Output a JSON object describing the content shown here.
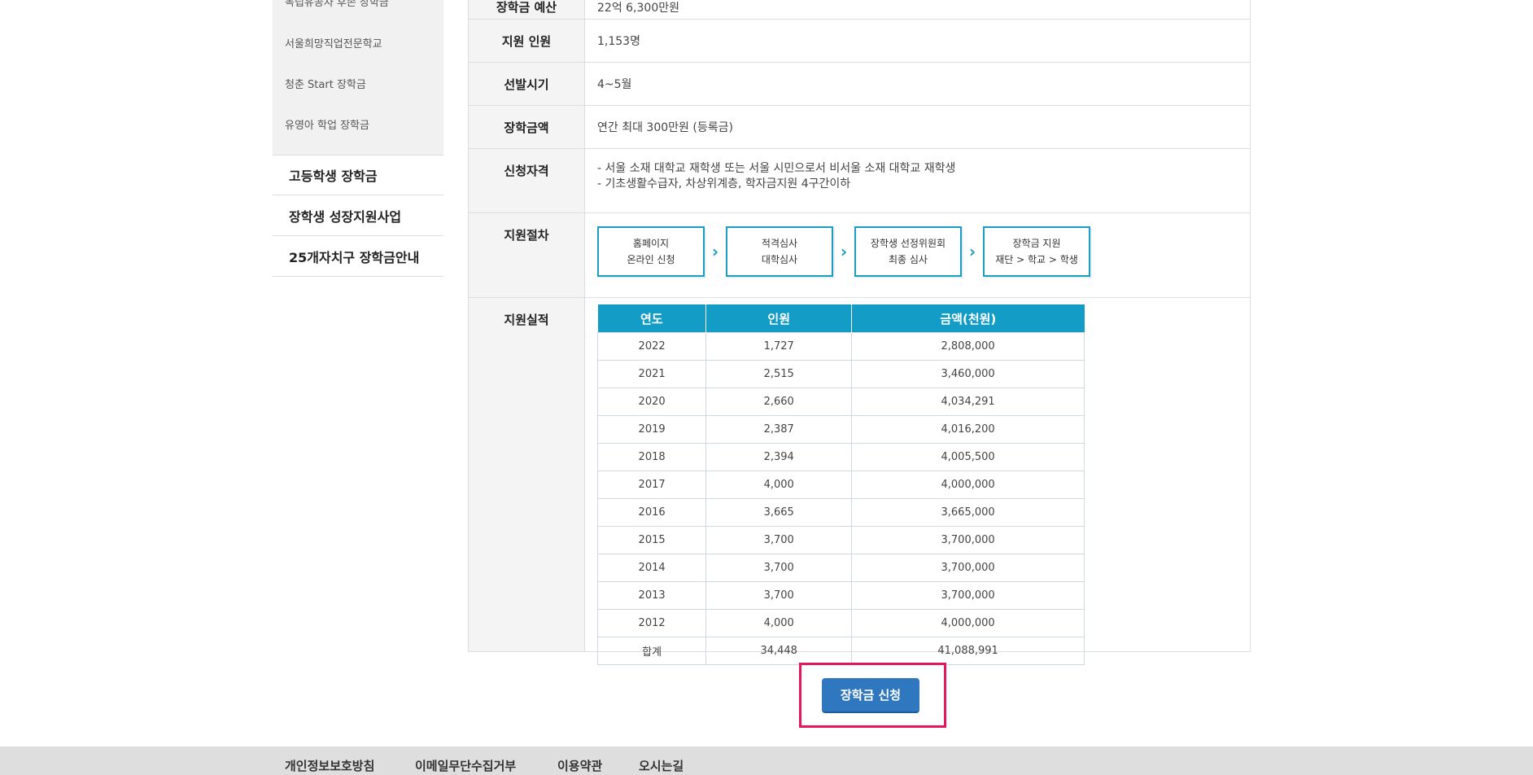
{
  "sidebar": {
    "sub_items": [
      "독립유공자 후손 장학금",
      "서울희망직업전문학교",
      "청춘 Start 장학금",
      "유영아 학업 장학금"
    ],
    "main_items": [
      "고등학생 장학금",
      "장학생 성장지원사업",
      "25개자치구 장학금안내"
    ]
  },
  "info": {
    "top_label": "장학금 예산",
    "top_value": "22억 6,300만원",
    "rows": {
      "people": {
        "label": "지원 인원",
        "value": "1,153명"
      },
      "period": {
        "label": "선발시기",
        "value": "4~5월"
      },
      "amount": {
        "label": "장학금액",
        "value": "연간 최대 300만원 (등록금)"
      },
      "eligibility": {
        "label": "신청자격",
        "line1": "- 서울 소재 대학교 재학생 또는 서울 시민으로서 비서울 소재 대학교 재학생",
        "line2": "- 기초생활수급자, 차상위계층, 학자금지원 4구간이하"
      },
      "procedure": {
        "label": "지원절차",
        "steps": [
          {
            "line1": "홈페이지",
            "line2": "온라인 신청"
          },
          {
            "line1": "적격심사",
            "line2": "대학심사"
          },
          {
            "line1": "장학생 선정위원회",
            "line2": "최종 심사"
          },
          {
            "line1": "장학금 지원",
            "line2": "재단 > 학교 > 학생"
          }
        ]
      },
      "results": {
        "label": "지원실적",
        "headers": [
          "연도",
          "인원",
          "금액(천원)"
        ],
        "rows": [
          [
            "2022",
            "1,727",
            "2,808,000"
          ],
          [
            "2021",
            "2,515",
            "3,460,000"
          ],
          [
            "2020",
            "2,660",
            "4,034,291"
          ],
          [
            "2019",
            "2,387",
            "4,016,200"
          ],
          [
            "2018",
            "2,394",
            "4,005,500"
          ],
          [
            "2017",
            "4,000",
            "4,000,000"
          ],
          [
            "2016",
            "3,665",
            "3,665,000"
          ],
          [
            "2015",
            "3,700",
            "3,700,000"
          ],
          [
            "2014",
            "3,700",
            "3,700,000"
          ],
          [
            "2013",
            "3,700",
            "3,700,000"
          ],
          [
            "2012",
            "4,000",
            "4,000,000"
          ],
          [
            "합계",
            "34,448",
            "41,088,991"
          ]
        ]
      }
    }
  },
  "apply_button": "장학금 신청",
  "footer": {
    "links": [
      "개인정보보호방침",
      "이메일무단수집거부",
      "이용약관",
      "오시는길"
    ]
  },
  "colors": {
    "accent": "#139cc5",
    "button": "#2f77be",
    "highlight": "#e5175a"
  }
}
